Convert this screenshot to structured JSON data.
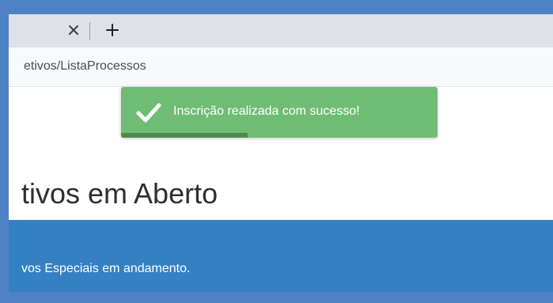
{
  "browser": {
    "tab_close_glyph": "×",
    "new_tab_glyph": "+",
    "url": "etivos/ListaProcessos"
  },
  "page": {
    "title": "tivos em Aberto",
    "band_text": "vos Especiais em andamento."
  },
  "toast": {
    "message": "Inscrição realizada com sucesso!",
    "icon": "checkmark-icon",
    "progress": 0.4,
    "colors": {
      "background": "#6fbd74",
      "progress": "#4e8851"
    }
  },
  "colors": {
    "frame": "#4f82c4",
    "band": "#3580c3"
  }
}
